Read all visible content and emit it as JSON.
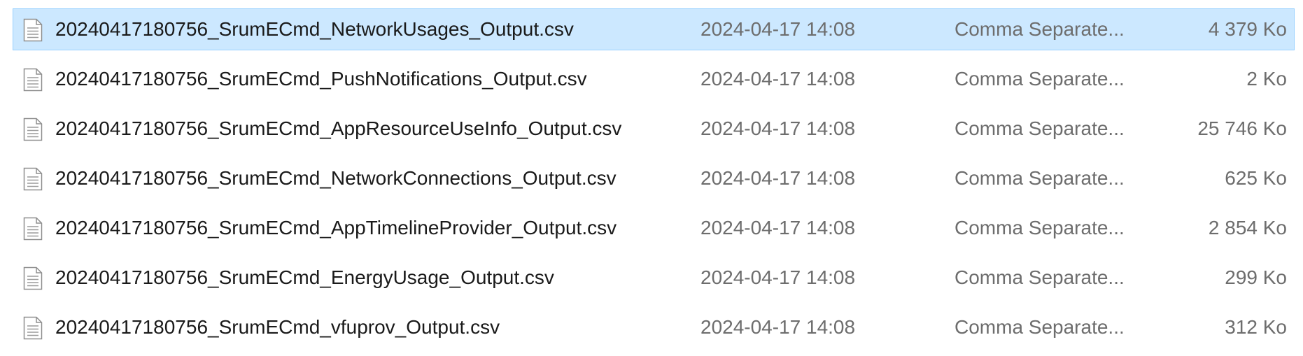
{
  "files": [
    {
      "name": "20240417180756_SrumECmd_NetworkUsages_Output.csv",
      "date": "2024-04-17 14:08",
      "type": "Comma Separate...",
      "size": "4 379 Ko",
      "selected": true,
      "icon": "csv-file-icon"
    },
    {
      "name": "20240417180756_SrumECmd_PushNotifications_Output.csv",
      "date": "2024-04-17 14:08",
      "type": "Comma Separate...",
      "size": "2 Ko",
      "selected": false,
      "icon": "csv-file-icon"
    },
    {
      "name": "20240417180756_SrumECmd_AppResourceUseInfo_Output.csv",
      "date": "2024-04-17 14:08",
      "type": "Comma Separate...",
      "size": "25 746 Ko",
      "selected": false,
      "icon": "csv-file-icon"
    },
    {
      "name": "20240417180756_SrumECmd_NetworkConnections_Output.csv",
      "date": "2024-04-17 14:08",
      "type": "Comma Separate...",
      "size": "625 Ko",
      "selected": false,
      "icon": "csv-file-icon"
    },
    {
      "name": "20240417180756_SrumECmd_AppTimelineProvider_Output.csv",
      "date": "2024-04-17 14:08",
      "type": "Comma Separate...",
      "size": "2 854 Ko",
      "selected": false,
      "icon": "csv-file-icon"
    },
    {
      "name": "20240417180756_SrumECmd_EnergyUsage_Output.csv",
      "date": "2024-04-17 14:08",
      "type": "Comma Separate...",
      "size": "299 Ko",
      "selected": false,
      "icon": "csv-file-icon"
    },
    {
      "name": "20240417180756_SrumECmd_vfuprov_Output.csv",
      "date": "2024-04-17 14:08",
      "type": "Comma Separate...",
      "size": "312 Ko",
      "selected": false,
      "icon": "csv-file-icon"
    }
  ],
  "colors": {
    "selection_background": "#cce8ff",
    "selection_border": "#99d1ff",
    "name_text": "#1a1a1a",
    "secondary_text": "#6d6d6d"
  }
}
